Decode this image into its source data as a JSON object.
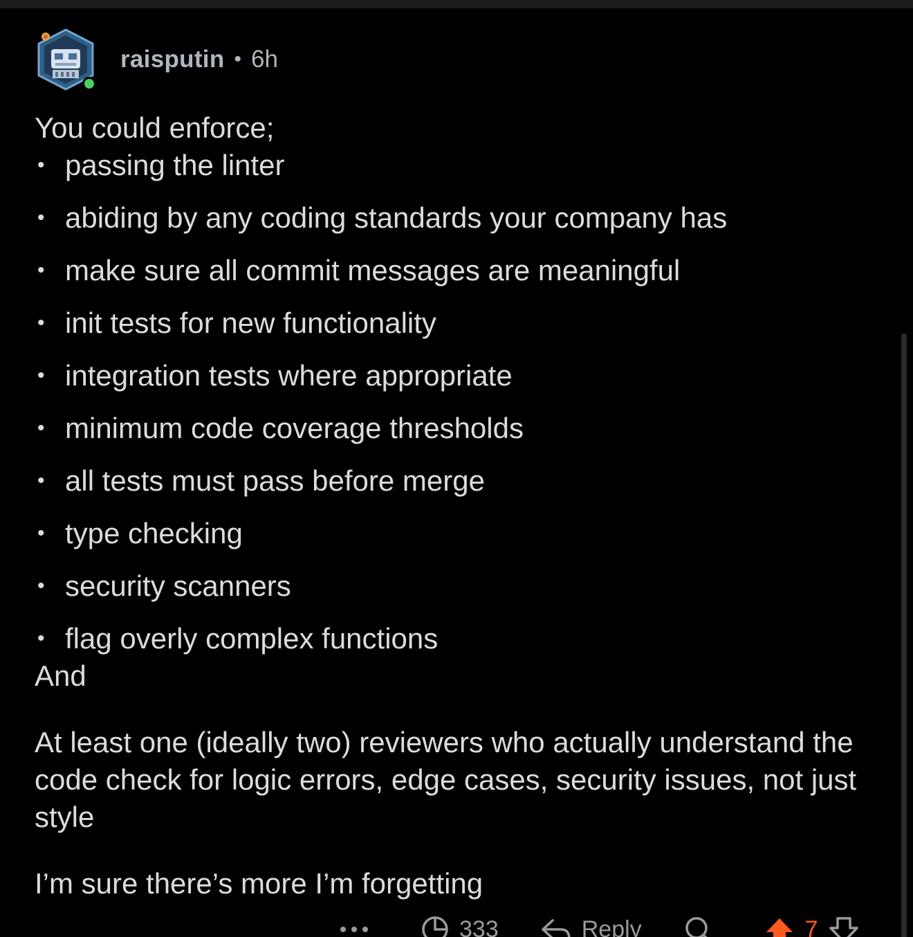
{
  "comment": {
    "author": "raisputin",
    "separator": "•",
    "time": "6h",
    "intro": "You could enforce;",
    "bullets": [
      "passing the linter",
      "abiding by any coding standards your company has",
      "make sure all commit messages are meaningful",
      "init tests for new functionality",
      "integration tests where appropriate",
      "minimum code coverage thresholds",
      "all tests must pass before merge",
      "type checking",
      "security scanners",
      "flag overly complex functions"
    ],
    "and_line": "And",
    "paragraph_1": "At least one (ideally two) reviewers who actually understand the code check for logic errors, edge cases, security issues, not just style",
    "paragraph_2": "I’m sure there’s more I’m forgetting"
  },
  "actions": {
    "more_icon": "ellipsis-icon",
    "awards_count": "333",
    "reply_label": "Reply",
    "vote_count": "7"
  },
  "colors": {
    "background": "#000000",
    "text": "#dcdcdc",
    "meta": "#b0b6bf",
    "online": "#46d160",
    "upvote": "#ff5a1f"
  }
}
